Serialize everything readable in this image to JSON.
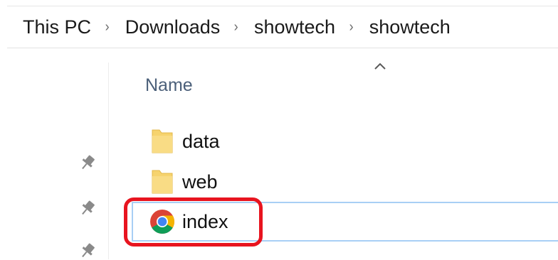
{
  "breadcrumb": {
    "items": [
      "This PC",
      "Downloads",
      "showtech",
      "showtech"
    ],
    "separator": "›"
  },
  "list": {
    "column_header": "Name",
    "files": [
      {
        "name": "data",
        "icon": "folder-icon"
      },
      {
        "name": "web",
        "icon": "folder-icon"
      },
      {
        "name": "index",
        "icon": "chrome-icon"
      }
    ]
  },
  "colors": {
    "highlight": "#e8141f",
    "selection_border": "#a8cff5",
    "folder": "#f6d36e"
  }
}
